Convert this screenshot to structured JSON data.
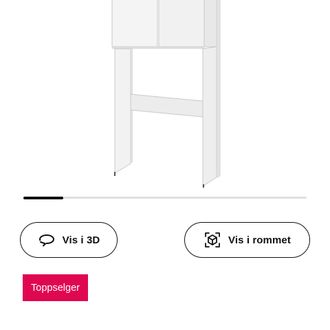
{
  "product": {
    "image_name": "white-cabinet-over-washing-machine"
  },
  "carousel": {
    "position": 0.14
  },
  "actions": {
    "view_3d": {
      "label": "Vis i 3D",
      "icon": "rotate-3d-icon"
    },
    "view_in_room": {
      "label": "Vis i rommet",
      "icon": "augmented-reality-icon"
    }
  },
  "badge": {
    "label": "Toppselger",
    "color": "#e00751"
  }
}
